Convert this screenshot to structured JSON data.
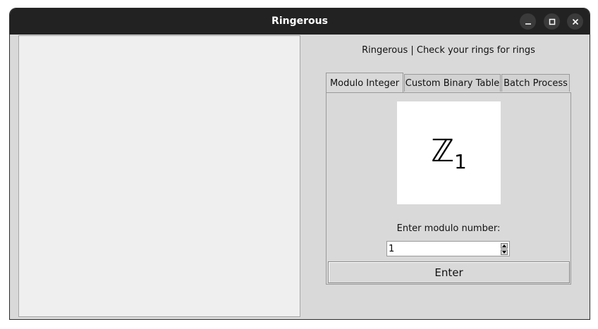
{
  "window": {
    "title": "Ringerous",
    "titlebar_color": "#222222",
    "background": "#d9d9d9"
  },
  "window_controls": [
    {
      "name": "minimize",
      "icon": "minimize-icon"
    },
    {
      "name": "maximize",
      "icon": "maximize-icon"
    },
    {
      "name": "close",
      "icon": "close-icon"
    }
  ],
  "heading": "Ringerous | Check your rings for rings",
  "tabs": [
    {
      "label": "Modulo Integer",
      "active": true
    },
    {
      "label": "Custom Binary Table",
      "active": false
    },
    {
      "label": "Batch Process",
      "active": false
    }
  ],
  "preview": {
    "symbol": "ℤ",
    "subscript": "1"
  },
  "modulo": {
    "prompt": "Enter modulo number:",
    "value": "1"
  },
  "enter_button": {
    "label": "Enter"
  }
}
